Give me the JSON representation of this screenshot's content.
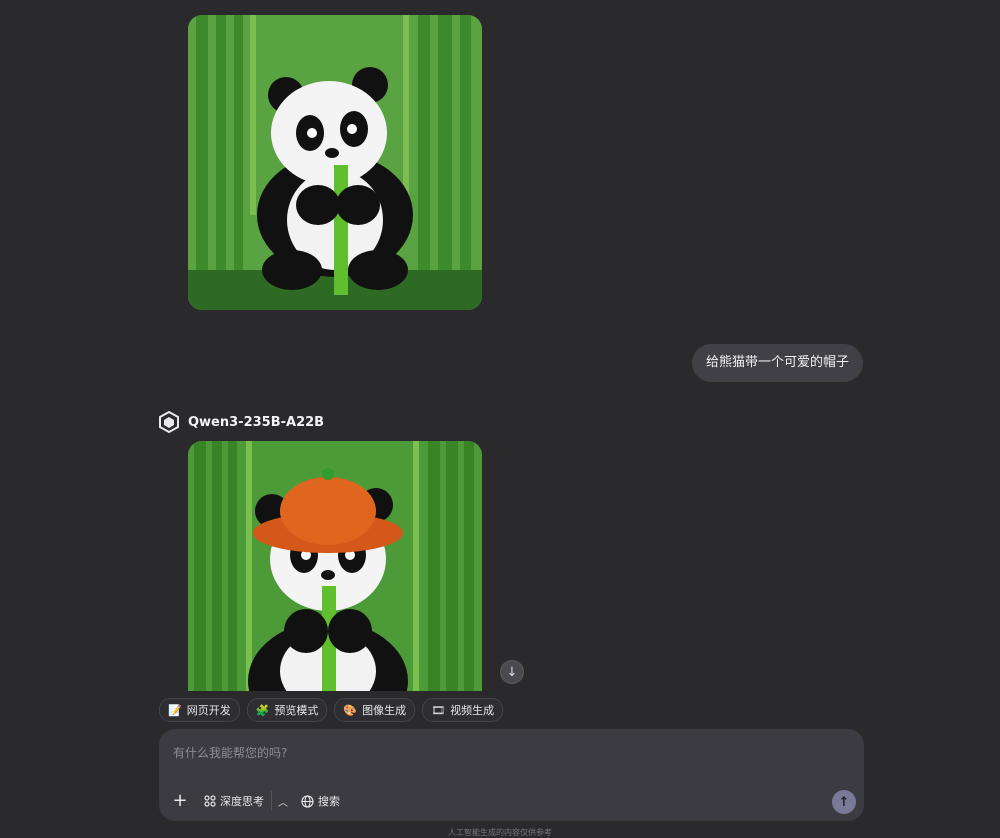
{
  "conversation": {
    "image1_alt": "",
    "user_message": "给熊猫带一个可爱的帽子",
    "model_name": "Qwen3-235B-A22B"
  },
  "chips": [
    {
      "icon": "📝",
      "label": "网页开发"
    },
    {
      "icon": "🧩",
      "label": "预览模式"
    },
    {
      "icon": "🎨",
      "label": "图像生成"
    },
    {
      "icon": "🎞",
      "label": "视频生成"
    }
  ],
  "composer": {
    "placeholder": "有什么我能帮您的吗?",
    "think_label": "深度思考",
    "search_label": "搜索"
  },
  "footer": {
    "disclaimer": "人工智能生成的内容仅供参考"
  },
  "colors": {
    "background": "#2a292c",
    "bubble": "#414046",
    "composer": "#3c3b41",
    "send": "#7a7a98"
  }
}
